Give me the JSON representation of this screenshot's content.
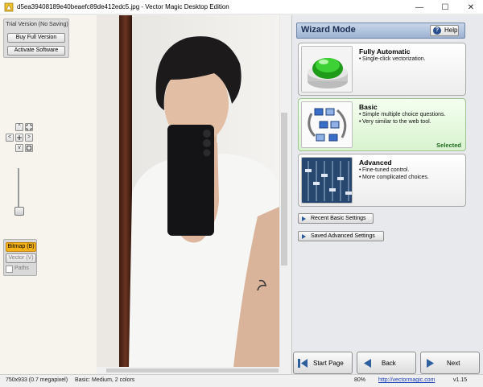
{
  "window": {
    "title": "d5ea39408189e40beaefc89de412edc5.jpg - Vector Magic Desktop Edition",
    "minimize_glyph": "—",
    "maximize_glyph": "☐",
    "close_glyph": "✕"
  },
  "toolbar": {
    "trial_label": "Trial Version (No Saving)",
    "buy_label": "Buy Full Version",
    "activate_label": "Activate Software",
    "nav": {
      "up": "^",
      "down": "v",
      "left": "<",
      "right": ">"
    },
    "views": {
      "bitmap": "Bitmap (B)",
      "vector": "Vector (V)",
      "paths": "Paths"
    },
    "active_color": "#f5b21a"
  },
  "wizard": {
    "title": "Wizard Mode",
    "help_label": "Help",
    "options": [
      {
        "title": "Fully Automatic",
        "bullets": [
          "Single-click vectorization."
        ],
        "selected": false
      },
      {
        "title": "Basic",
        "bullets": [
          "Simple multiple choice questions.",
          "Very similar to the web tool."
        ],
        "selected": true,
        "selected_label": "Selected"
      },
      {
        "title": "Advanced",
        "bullets": [
          "Fine-tuned control.",
          "More complicated choices."
        ],
        "selected": false
      }
    ],
    "recent_label": "Recent Basic Settings",
    "saved_label": "Saved Advanced Settings",
    "nav": {
      "start": "Start Page",
      "back": "Back",
      "next": "Next"
    }
  },
  "status": {
    "dimensions": "750x933 (0.7 megapixel)",
    "mode": "Basic: Medium, 2 colors",
    "zoom": "80%",
    "url": "http://vectormagic.com",
    "version": "v1.15"
  }
}
